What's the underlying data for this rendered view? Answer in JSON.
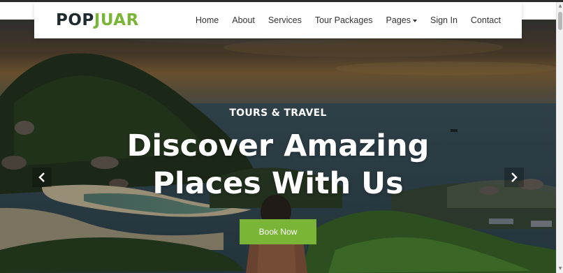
{
  "brand": {
    "part1": "POP",
    "part2": "JUAR"
  },
  "nav": {
    "items": [
      {
        "label": "Home"
      },
      {
        "label": "About"
      },
      {
        "label": "Services"
      },
      {
        "label": "Tour Packages"
      },
      {
        "label": "Pages",
        "dropdown": true
      },
      {
        "label": "Sign In"
      },
      {
        "label": "Contact"
      }
    ]
  },
  "hero": {
    "eyebrow": "TOURS & TRAVEL",
    "headline_line1": "Discover Amazing",
    "headline_line2": "Places With Us",
    "cta_label": "Book Now"
  },
  "carousel": {
    "prev_icon": "chevron-left-icon",
    "next_icon": "chevron-right-icon"
  },
  "colors": {
    "accent": "#7ab538",
    "brand_dark": "#1f2a2e",
    "nav_text": "#333333",
    "hero_text": "#ffffff"
  }
}
